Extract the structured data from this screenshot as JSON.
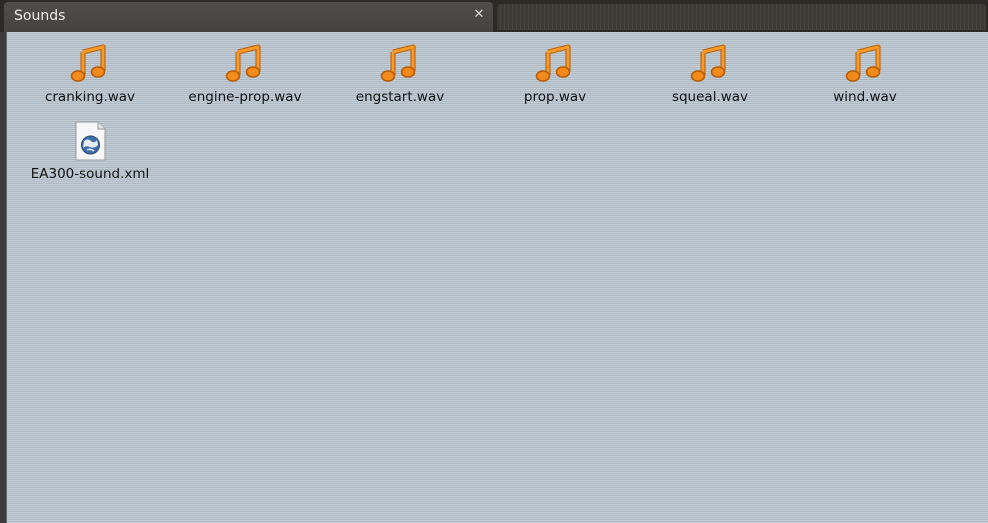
{
  "window": {
    "tab_title": "Sounds",
    "close_glyph": "✕"
  },
  "files": [
    {
      "name": "cranking.wav",
      "icon": "audio-file-icon"
    },
    {
      "name": "engine-prop.wav",
      "icon": "audio-file-icon"
    },
    {
      "name": "engstart.wav",
      "icon": "audio-file-icon"
    },
    {
      "name": "prop.wav",
      "icon": "audio-file-icon"
    },
    {
      "name": "squeal.wav",
      "icon": "audio-file-icon"
    },
    {
      "name": "wind.wav",
      "icon": "audio-file-icon"
    },
    {
      "name": "EA300-sound.xml",
      "icon": "xml-file-icon"
    }
  ],
  "colors": {
    "audio_icon": "#f28a1c",
    "audio_icon_outline": "#b85a00"
  }
}
